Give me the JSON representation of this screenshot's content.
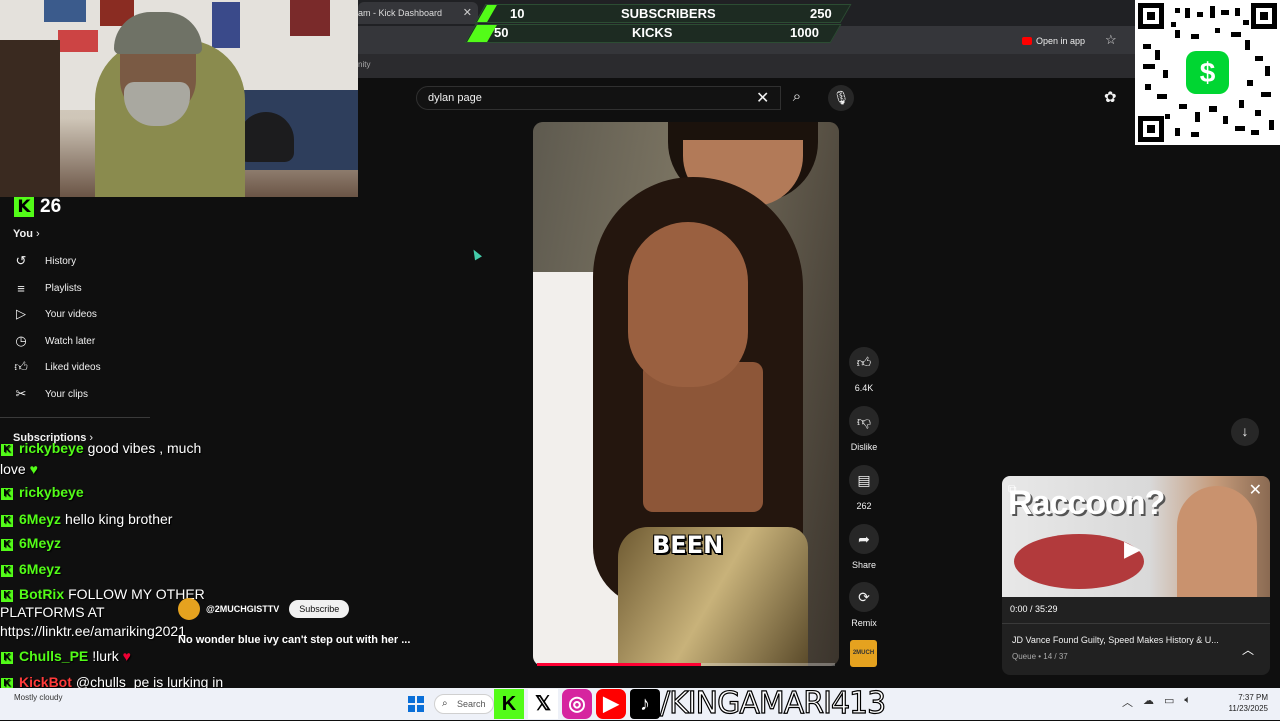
{
  "browser": {
    "tab_title": "am - Kick Dashboard",
    "open_in_app": "Open in app",
    "bookmark_text": "nity"
  },
  "goals": {
    "row1": {
      "current": "10",
      "label": "SUBSCRIBERS",
      "target": "250",
      "progress": 0.04
    },
    "row2": {
      "current": "50",
      "label": "KICKS",
      "target": "1000",
      "progress": 0.05
    }
  },
  "qr": {
    "symbol": "$",
    "accent": "#00d632"
  },
  "kick": {
    "viewer_count": "26",
    "brand_color": "#53fc18"
  },
  "sidebar": {
    "you_label": "You",
    "items": [
      {
        "label": "History",
        "icon": "history-icon"
      },
      {
        "label": "Playlists",
        "icon": "playlists-icon"
      },
      {
        "label": "Your videos",
        "icon": "your-videos-icon"
      },
      {
        "label": "Watch later",
        "icon": "watch-later-icon"
      },
      {
        "label": "Liked videos",
        "icon": "liked-icon"
      },
      {
        "label": "Your clips",
        "icon": "clips-icon"
      }
    ],
    "subscriptions_label": "Subscriptions"
  },
  "search": {
    "value": "dylan page"
  },
  "short": {
    "caption": "BEEN",
    "progress": 0.55,
    "title": "No wonder blue ivy can't step out with her ...",
    "channel": "@2MUCHGISTTV",
    "subscribe_label": "Subscribe",
    "channel_thumb_text": "2MUCH"
  },
  "actions": {
    "likes": "6.4K",
    "dislike_label": "Dislike",
    "comments": "262",
    "share_label": "Share",
    "remix_label": "Remix"
  },
  "miniplayer": {
    "overlay_text": "Raccoon?",
    "time": "0:00 / 35:29",
    "title": "JD Vance Found Guilty, Speed Makes History & U...",
    "queue": "Queue • 14 / 37"
  },
  "chat": [
    {
      "user": "rickybeye",
      "message": "good vibes , much",
      "color": "#53fc18"
    },
    {
      "user": "",
      "message": "love",
      "color": "#ffffff"
    },
    {
      "user": "rickybeye",
      "message": "",
      "color": "#53fc18"
    },
    {
      "user": "6Meyz",
      "message": "hello king brother",
      "color": "#53fc18"
    },
    {
      "user": "6Meyz",
      "message": "",
      "color": "#53fc18"
    },
    {
      "user": "6Meyz",
      "message": "",
      "color": "#53fc18"
    },
    {
      "user": "BotRix",
      "message": "FOLLOW MY OTHER",
      "color": "#53fc18"
    },
    {
      "user": "",
      "message": "PLATFORMS AT",
      "color": "#ffffff"
    },
    {
      "user": "",
      "message": "https://linktr.ee/amariking2021",
      "color": "#ffffff"
    },
    {
      "user": "Chulls_PE",
      "message": "!lurk",
      "color": "#53fc18"
    },
    {
      "user": "KickBot",
      "message": "@chulls_pe is lurking in",
      "color": "#ff3a3a"
    }
  ],
  "taskbar": {
    "weather_line1": "",
    "weather_line2": "Mostly cloudy",
    "search_label": "Search",
    "handle": "/KINGAMARI413",
    "time": "7:37 PM",
    "date": "11/23/2025"
  }
}
